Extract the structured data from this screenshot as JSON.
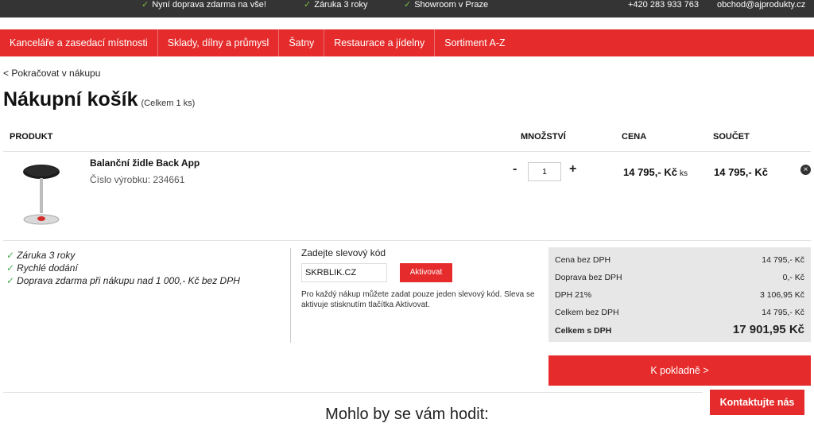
{
  "topbar": {
    "usps": [
      "Nyní doprava zdarma na vše!",
      "Záruka 3 roky",
      "Showroom v Praze"
    ],
    "phone": "+420 283 933 763",
    "email": "obchod@ajprodukty.cz"
  },
  "nav": {
    "items": [
      "Kanceláře a zasedací místnosti",
      "Sklady, dílny a průmysl",
      "Šatny",
      "Restaurace a jídelny",
      "Sortiment A-Z"
    ]
  },
  "cart": {
    "back_link": "< Pokračovat v nákupu",
    "title": "Nákupní košík",
    "subtitle": "(Celkem 1 ks)",
    "columns": {
      "product": "PRODUKT",
      "quantity": "MNOŽSTVÍ",
      "price": "CENA",
      "total": "SOUČET"
    },
    "item": {
      "name": "Balanční židle Back App",
      "code": "Číslo výrobku: 234661",
      "qty_minus": "-",
      "qty_plus": "+",
      "quantity": "1",
      "price": "14 795,- Kč",
      "unit": "ks",
      "total": "14 795,- Kč",
      "remove_icon": "×"
    }
  },
  "benefits": [
    "Záruka 3 roky",
    "Rychlé dodání",
    "Doprava zdarma při nákupu nad 1 000,- Kč bez DPH"
  ],
  "coupon": {
    "label": "Zadejte slevový kód",
    "value": "SKRBLIK.CZ",
    "button": "Aktivovat",
    "note": "Pro každý nákup můžete zadat pouze jeden slevový kód. Sleva se aktivuje stisknutím tlačítka Aktivovat."
  },
  "summary": {
    "rows": [
      {
        "label": "Cena bez DPH",
        "value": "14 795,- Kč"
      },
      {
        "label": "Doprava bez DPH",
        "value": "0,- Kč"
      },
      {
        "label": "DPH 21%",
        "value": "3 106,95 Kč"
      },
      {
        "label": "Celkem bez DPH",
        "value": "14 795,- Kč"
      },
      {
        "label": "Celkem s DPH",
        "value": "17 901,95 Kč"
      }
    ]
  },
  "checkout_button": "K pokladně >",
  "suggest_title": "Mohlo by se vám hodit:",
  "contact_button": "Kontaktujte nás",
  "colors": {
    "brand_red": "#e52b2b",
    "topbar": "#343434",
    "check_green": "#7bc043"
  }
}
